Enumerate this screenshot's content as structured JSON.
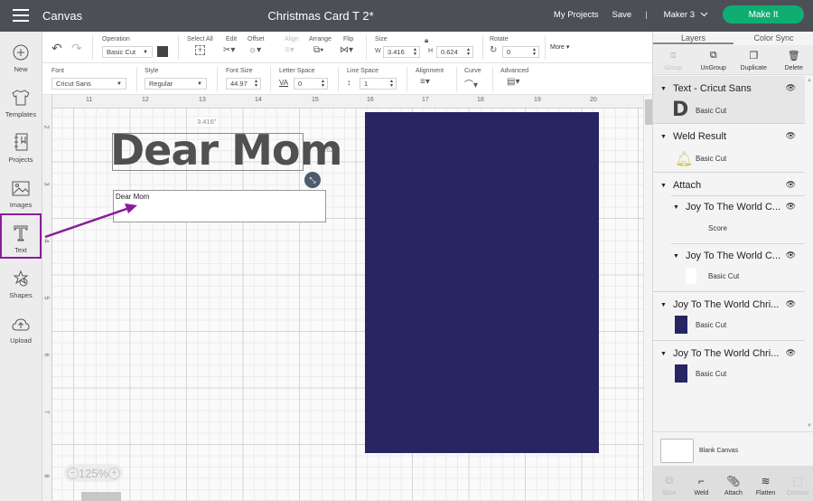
{
  "topbar": {
    "app_title": "Canvas",
    "document_title": "Christmas Card T 2*",
    "my_projects": "My Projects",
    "save": "Save",
    "separator": "|",
    "machine": "Maker 3",
    "make_it": "Make It"
  },
  "leftnav": [
    {
      "label": "New",
      "icon": "plus-circle-icon"
    },
    {
      "label": "Templates",
      "icon": "tshirt-icon"
    },
    {
      "label": "Projects",
      "icon": "notebook-icon"
    },
    {
      "label": "Images",
      "icon": "image-icon"
    },
    {
      "label": "Text",
      "icon": "text-t-icon",
      "active": true
    },
    {
      "label": "Shapes",
      "icon": "shapes-icon"
    },
    {
      "label": "Upload",
      "icon": "cloud-upload-icon"
    }
  ],
  "toolbar1": {
    "operation_label": "Operation",
    "operation_value": "Basic Cut",
    "operation_color": "#444444",
    "select_all": "Select All",
    "edit": "Edit",
    "offset": "Offset",
    "align": "Align",
    "arrange": "Arrange",
    "flip": "Flip",
    "size": "Size",
    "w_label": "W",
    "w_value": "3.416",
    "h_label": "H",
    "h_value": "0.624",
    "rotate": "Rotate",
    "rotate_value": "0",
    "more": "More"
  },
  "toolbar2": {
    "font_label": "Font",
    "font_value": "Cricut Sans",
    "style_label": "Style",
    "style_value": "Regular",
    "font_size_label": "Font Size",
    "font_size_value": "44.97",
    "letter_space_label": "Letter Space",
    "letter_space_icon": "VA",
    "letter_space_value": "0",
    "line_space_label": "Line Space",
    "line_space_value": "1",
    "alignment_label": "Alignment",
    "curve_label": "Curve",
    "advanced_label": "Advanced"
  },
  "canvas": {
    "h_ruler": [
      "11",
      "12",
      "13",
      "14",
      "15",
      "16",
      "17",
      "18",
      "19",
      "20"
    ],
    "v_ruler": [
      "2",
      "3",
      "4",
      "5",
      "6",
      "7",
      "8"
    ],
    "text_object": "Dear Mom",
    "width_label": "3.416\"",
    "height_label": "0.624\"",
    "text_input_value": "Dear Mom",
    "zoom_level": "125%",
    "mat_color": "#272562",
    "annotation_color": "#8b1c9b"
  },
  "rpanel": {
    "tabs": [
      "Layers",
      "Color Sync"
    ],
    "actions": [
      {
        "label": "Group",
        "disabled": true,
        "icon": "group-icon"
      },
      {
        "label": "UnGroup",
        "disabled": false,
        "icon": "ungroup-icon"
      },
      {
        "label": "Duplicate",
        "disabled": false,
        "icon": "duplicate-icon"
      },
      {
        "label": "Delete",
        "disabled": false,
        "icon": "trash-icon"
      }
    ],
    "layers": [
      {
        "title": "Text - Cricut Sans",
        "sub": "Basic Cut"
      },
      {
        "title": "Weld Result",
        "sub": "Basic Cut"
      },
      {
        "title": "Attach",
        "children": [
          {
            "title": "Joy To The World C...",
            "sub": "Score"
          },
          {
            "title": "Joy To The World C...",
            "sub": "Basic Cut"
          }
        ]
      },
      {
        "title": "Joy To The World Chri...",
        "sub": "Basic Cut"
      },
      {
        "title": "Joy To The World Chri...",
        "sub": "Basic Cut"
      }
    ],
    "blank_canvas": "Blank Canvas",
    "bottom_actions": [
      {
        "label": "Slice",
        "disabled": true
      },
      {
        "label": "Weld",
        "disabled": false
      },
      {
        "label": "Attach",
        "disabled": false
      },
      {
        "label": "Flatten",
        "disabled": false
      },
      {
        "label": "Contour",
        "disabled": true
      }
    ]
  }
}
